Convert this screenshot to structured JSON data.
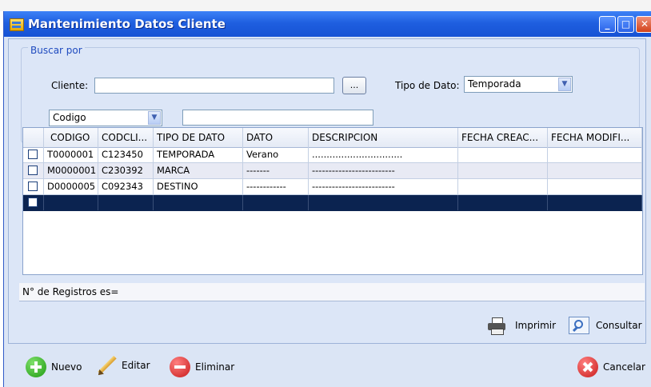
{
  "window": {
    "title": "Mantenimiento Datos Cliente"
  },
  "search": {
    "group_title": "Buscar por",
    "cliente_label": "Cliente:",
    "cliente_value": "",
    "browse_label": "...",
    "tipo_label": "Tipo de Dato:",
    "tipo_value": "Temporada",
    "field_value": "Codigo",
    "filter_value": ""
  },
  "grid": {
    "columns": [
      "CODIGO",
      "CODCLI...",
      "TIPO DE DATO",
      "DATO",
      "DESCRIPCION",
      "FECHA CREAC...",
      "FECHA MODIFI..."
    ],
    "rows": [
      [
        "T0000001",
        "C123450",
        "TEMPORADA",
        "Verano",
        "...............................",
        "",
        ""
      ],
      [
        "M0000001",
        "C230392",
        "MARCA",
        "-------",
        "-------------------------",
        "",
        ""
      ],
      [
        "D0000005",
        "C092343",
        "DESTINO",
        "------------",
        "-------------------------",
        "",
        ""
      ]
    ]
  },
  "status": {
    "record_count_label": "N° de Registros es="
  },
  "actions": {
    "print_label": "Imprimir",
    "consult_label": "Consultar",
    "new_label": "Nuevo",
    "edit_label": "Editar",
    "delete_label": "Eliminar",
    "cancel_label": "Cancelar"
  },
  "colors": {
    "titlebar": "#1f5fe0",
    "selected_row": "#0b2350",
    "panel": "#dce6f7"
  },
  "icons": [
    "window-app-icon",
    "minimize-icon",
    "maximize-icon",
    "close-icon",
    "dropdown-arrow-icon",
    "printer-icon",
    "magnifier-icon",
    "plus-icon",
    "pencil-icon",
    "minus-icon",
    "cancel-x-icon"
  ]
}
